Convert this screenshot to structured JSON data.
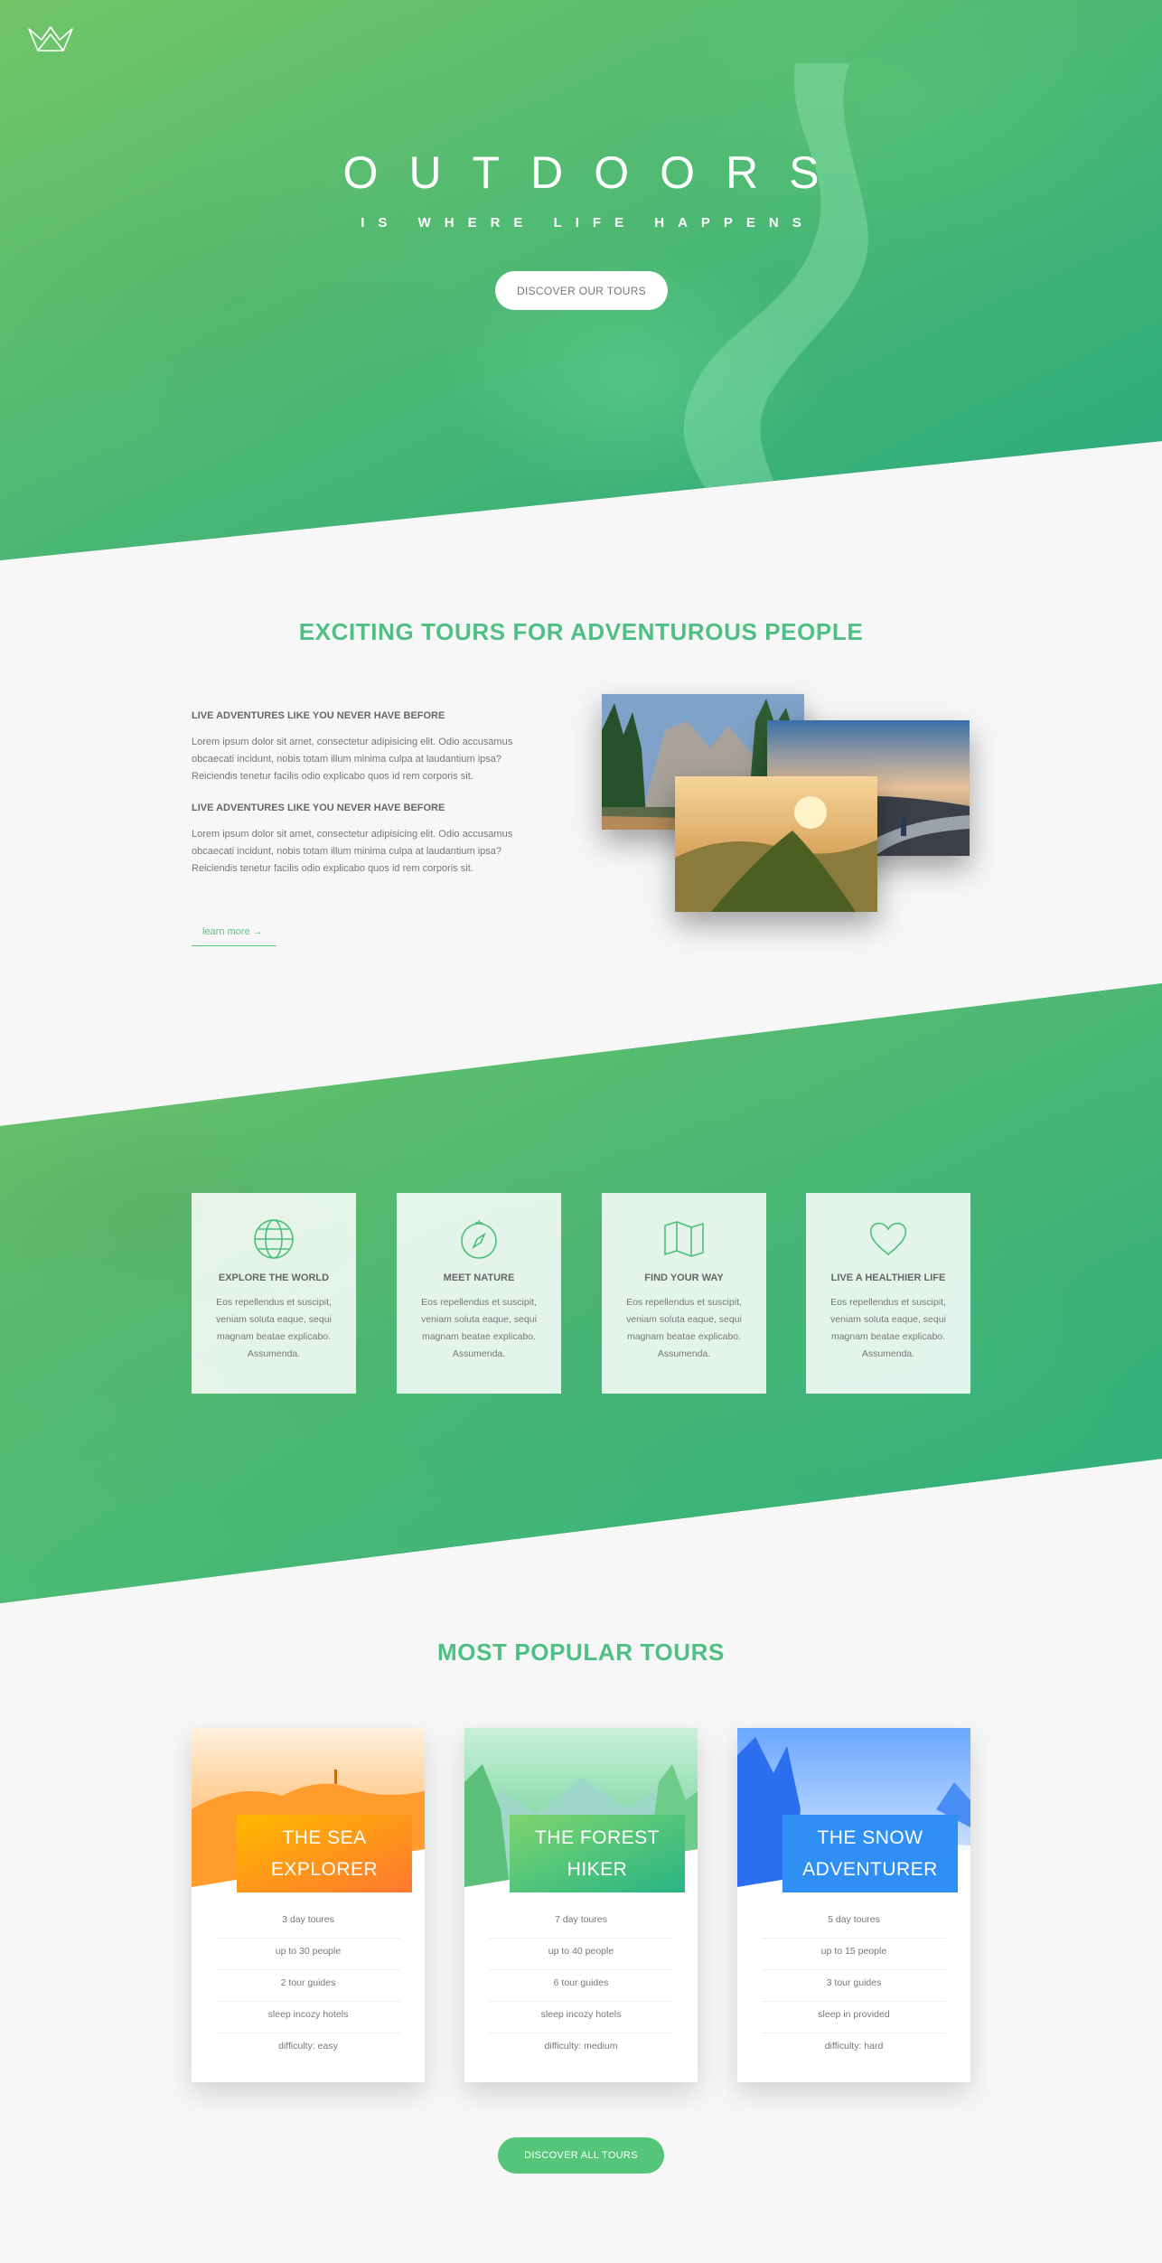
{
  "hero": {
    "title": "OUTDOORS",
    "subtitle": "IS WHERE LIFE HAPPENS",
    "cta_label": "DISCOVER OUR TOURS",
    "logo_icon": "crown-logo-icon"
  },
  "about": {
    "heading": "EXCITING TOURS FOR ADVENTUROUS PEOPLE",
    "blocks": [
      {
        "title": "LIVE ADVENTURES LIKE YOU NEVER HAVE BEFORE",
        "text": "Lorem ipsum dolor sit amet, consectetur adipisicing elit. Odio accusamus obcaecati incidunt, nobis totam illum minima culpa at laudantium ipsa? Reiciendis tenetur facilis odio explicabo quos id rem corporis sit."
      },
      {
        "title": "LIVE ADVENTURES LIKE YOU NEVER HAVE BEFORE",
        "text": "Lorem ipsum dolor sit amet, consectetur adipisicing elit. Odio accusamus obcaecati incidunt, nobis totam illum minima culpa at laudantium ipsa? Reiciendis tenetur facilis odio explicabo quos id rem corporis sit."
      }
    ],
    "link_label": "learn more →"
  },
  "features": [
    {
      "icon": "globe-icon",
      "title": "EXPLORE THE WORLD",
      "text": "Eos repellendus et suscipit, veniam soluta eaque, sequi magnam beatae explicabo. Assumenda."
    },
    {
      "icon": "compass-icon",
      "title": "MEET NATURE",
      "text": "Eos repellendus et suscipit, veniam soluta eaque, sequi magnam beatae explicabo. Assumenda."
    },
    {
      "icon": "map-icon",
      "title": "FIND YOUR WAY",
      "text": "Eos repellendus et suscipit, veniam soluta eaque, sequi magnam beatae explicabo. Assumenda."
    },
    {
      "icon": "heart-icon",
      "title": "LIVE A HEALTHIER LIFE",
      "text": "Eos repellendus et suscipit, veniam soluta eaque, sequi magnam beatae explicabo. Assumenda."
    }
  ],
  "tours": {
    "heading": "MOST POPULAR TOURS",
    "cards": [
      {
        "title_1": "THE SEA",
        "title_2": "EXPLORER",
        "color": "#ff9a1a",
        "details": [
          "3 day toures",
          "up to 30 people",
          "2 tour guides",
          "sleep incozy hotels",
          "difficulty: easy"
        ]
      },
      {
        "title_1": "THE FOREST",
        "title_2": "HIKER",
        "color": "#55c57a",
        "details": [
          "7 day toures",
          "up to 40 people",
          "6 tour guides",
          "sleep incozy hotels",
          "difficulty: medium"
        ]
      },
      {
        "title_1": "THE SNOW",
        "title_2": "ADVENTURER",
        "color": "#2f8ff5",
        "details": [
          "5 day toures",
          "up to 15 people",
          "3 tour guides",
          "sleep in provided",
          "difficulty: hard"
        ]
      }
    ],
    "cta_label": "DISCOVER ALL TOURS"
  },
  "colors": {
    "primary": "#55c57a",
    "primary_light": "#7ed56f",
    "primary_dark": "#28b485",
    "background": "#f7f7f7"
  }
}
